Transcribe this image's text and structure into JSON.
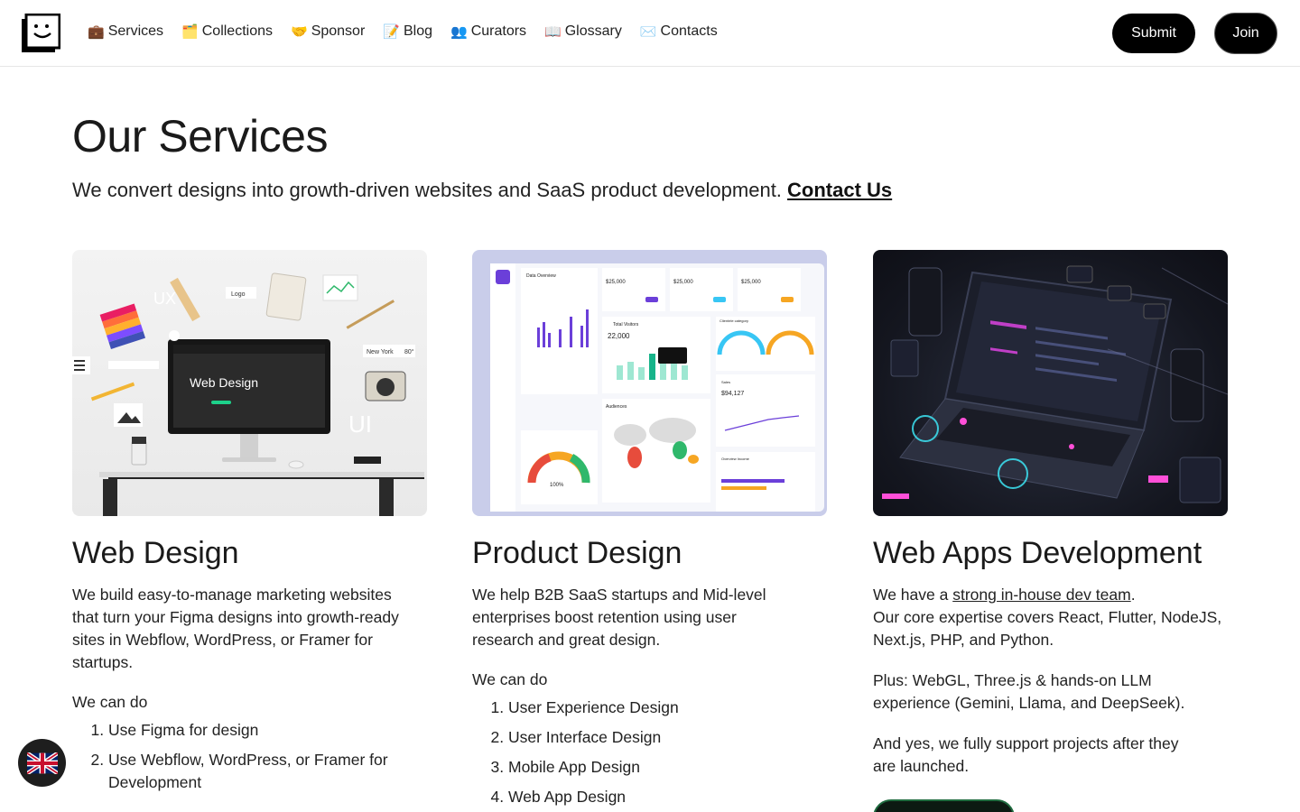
{
  "header": {
    "nav": [
      {
        "emoji": "💼",
        "label": "Services",
        "icon": "briefcase-icon"
      },
      {
        "emoji": "🗂️",
        "label": "Collections",
        "icon": "folder-icon"
      },
      {
        "emoji": "🤝",
        "label": "Sponsor",
        "icon": "handshake-icon"
      },
      {
        "emoji": "📝",
        "label": "Blog",
        "icon": "memo-icon"
      },
      {
        "emoji": "👥",
        "label": "Curators",
        "icon": "people-icon"
      },
      {
        "emoji": "📖",
        "label": "Glossary",
        "icon": "book-icon"
      },
      {
        "emoji": "✉️",
        "label": "Contacts",
        "icon": "envelope-icon"
      }
    ],
    "submit_label": "Submit",
    "join_label": "Join"
  },
  "hero": {
    "title": "Our Services",
    "subtitle": "We convert designs into growth-driven websites and SaaS product development.",
    "contact_link": "Contact Us"
  },
  "cards": [
    {
      "title": "Web Design",
      "text": "We build easy-to-manage marketing websites that turn your Figma designs into growth-ready sites in Webflow, WordPress, or Framer for startups.",
      "can_do": "We can do",
      "items": [
        "Use Figma for design",
        "Use Webflow, WordPress, or Framer for Development"
      ],
      "image": {
        "monitor_title": "Web Design",
        "ux": "UX",
        "ui": "UI",
        "logo": "Logo",
        "city": "New York",
        "temp": "80°"
      }
    },
    {
      "title": "Product Design",
      "text": "We help B2B SaaS startups and Mid-level enterprises boost retention using user research and great design.",
      "can_do": "We can do",
      "items": [
        "User Experience Design",
        "User Interface Design",
        "Mobile App Design",
        "Web App Design"
      ],
      "image": {
        "panel_title": "Data Overview",
        "visitors_label": "Total Visitors",
        "visitors_value": "22,000",
        "stat1": "$25,000",
        "stat2": "$25,000",
        "stat3": "$25,000",
        "sales_label": "Sales",
        "sales_value": "$94,127",
        "audience_label": "Audiences",
        "gauge_value": "100%",
        "income_label": "Overview Income",
        "category_label": "Clientele category"
      }
    },
    {
      "title": "Web Apps Development",
      "text_prefix": "We have a ",
      "text_link": "strong in-house dev team",
      "text_suffix": ".",
      "text2": "Our core expertise covers React, Flutter, NodeJS, Next.js, PHP, and Python.",
      "text3": "Plus: WebGL, Three.js & hands-on LLM experience (Gemini, Llama, and DeepSeek).",
      "text4": "And yes, we fully support projects after they are launched."
    }
  ],
  "language": {
    "icon": "uk-flag-icon"
  },
  "colors": {
    "accent": "#000000",
    "cta_border": "#1f6b3f"
  }
}
